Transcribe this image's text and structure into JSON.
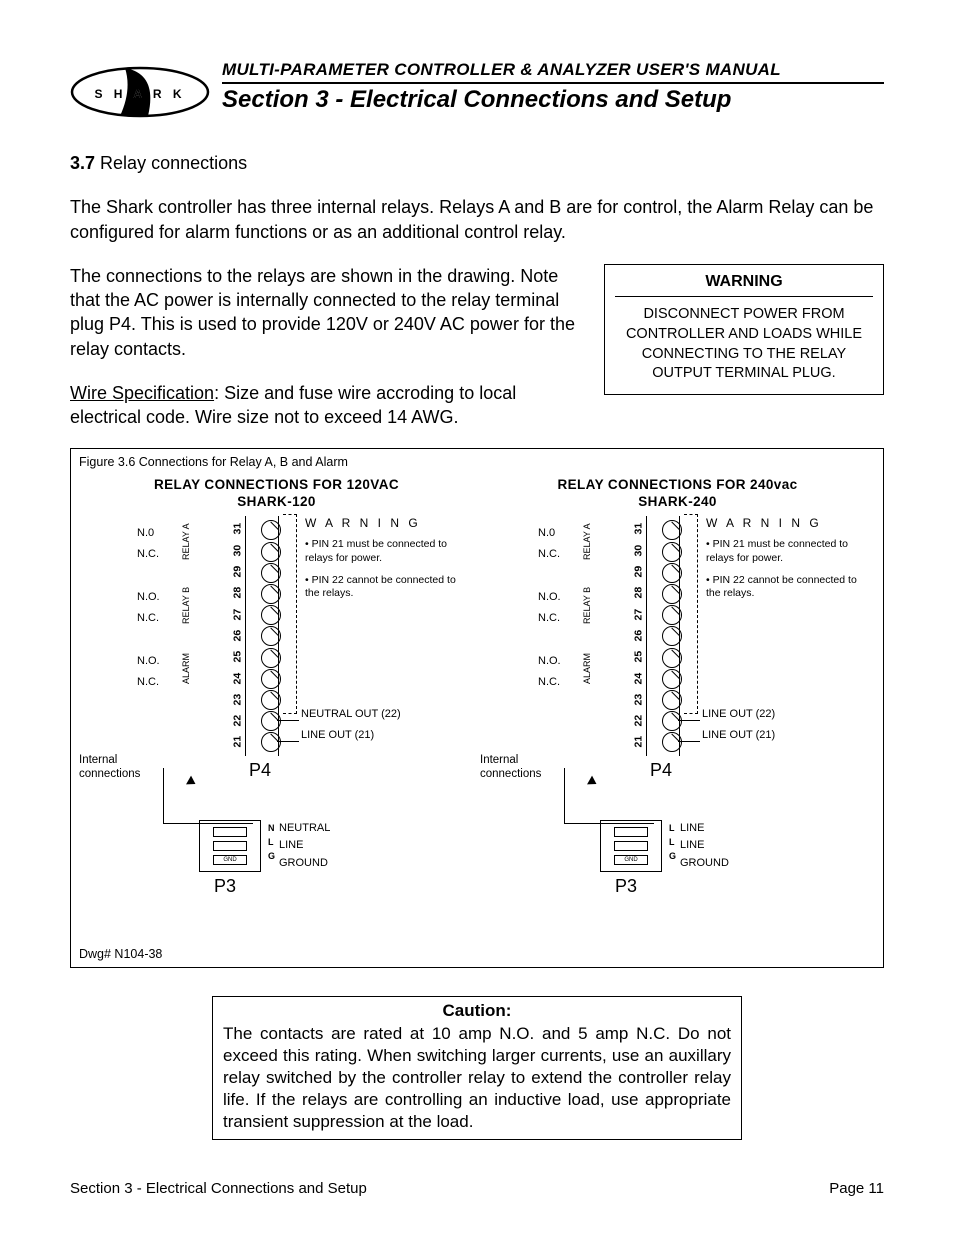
{
  "header": {
    "manual_title": "MULTI-PARAMETER CONTROLLER & ANALYZER USER'S MANUAL",
    "section_title": "Section 3 - Electrical Connections and Setup",
    "logo_text": "S H A R K"
  },
  "section": {
    "number": "3.7",
    "heading": "Relay connections",
    "para1": "The Shark controller has three internal relays. Relays A and B are for control, the Alarm Relay can be configured for alarm functions or as an additional control relay.",
    "para2": "The connections to the relays are shown in the drawing. Note that the AC power is internally connected to the relay terminal plug P4. This is used to provide 120V or 240V AC power for the relay contacts.",
    "wirespec_label": "Wire Specification",
    "wirespec_text": ": Size and fuse wire accroding to local electrical code. Wire size not to exceed 14 AWG."
  },
  "warning_box": {
    "heading": "WARNING",
    "body": "DISCONNECT POWER FROM CONTROLLER AND LOADS WHILE CONNECTING TO THE RELAY OUTPUT TERMINAL PLUG."
  },
  "figure": {
    "caption": "Figure 3.6  Connections for Relay A, B and Alarm",
    "dwg": "Dwg# N104-38",
    "pins": [
      "31",
      "30",
      "29",
      "28",
      "27",
      "26",
      "25",
      "24",
      "23",
      "22",
      "21"
    ],
    "relay_rows": [
      "N.0",
      "N.C.",
      "",
      "N.O.",
      "N.C.",
      "",
      "N.O.",
      "N.C.",
      "",
      "",
      ""
    ],
    "relay_groups": [
      "RELAY A",
      "RELAY B",
      "ALARM"
    ],
    "side_warn_heading": "W A R N I N G",
    "side_warn_1": "PIN 21 must be connected to relays for power.",
    "side_warn_2": "PIN 22 cannot be connected to the relays.",
    "p4_label": "P4",
    "p3_label": "P3",
    "int_conn": "Internal\nconnections",
    "gnd": "GND",
    "left": {
      "title_line1": "RELAY CONNECTIONS FOR 120VAC",
      "title_line2": "SHARK-120",
      "out22": "NEUTRAL OUT (22)",
      "out21": "LINE OUT (21)",
      "p3_pins": [
        "N",
        "L",
        "G"
      ],
      "p3_labels": [
        "NEUTRAL",
        "LINE",
        "GROUND"
      ]
    },
    "right": {
      "title_line1": "RELAY CONNECTIONS FOR 240vac",
      "title_line2": "SHARK-240",
      "out22": "LINE OUT (22)",
      "out21": "LINE OUT (21)",
      "p3_pins": [
        "L",
        "L",
        "G"
      ],
      "p3_labels": [
        "LINE",
        "LINE",
        "GROUND"
      ]
    }
  },
  "caution": {
    "heading": "Caution:",
    "body": "The contacts are rated at 10 amp N.O. and 5 amp N.C. Do not exceed this rating. When switching larger currents, use an auxillary relay switched by the controller relay to extend the controller relay life. If the relays are controlling an inductive load, use appropriate transient suppression at the load."
  },
  "footer": {
    "left": "Section 3 - Electrical Connections and Setup",
    "right": "Page 11"
  }
}
